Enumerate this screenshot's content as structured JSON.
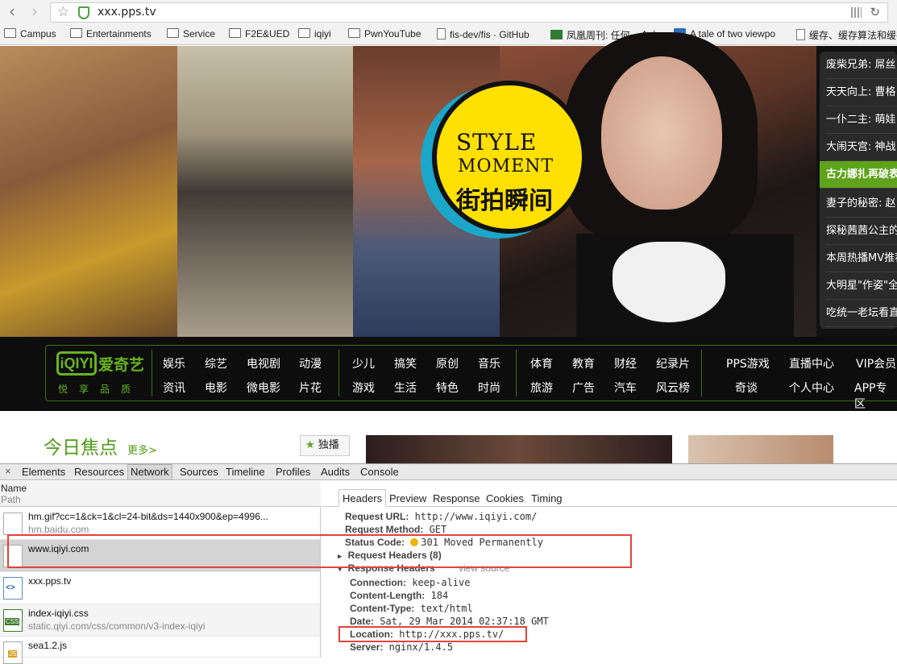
{
  "browser": {
    "url": "xxx.pps.tv",
    "bookmarks": [
      {
        "label": "Campus",
        "icon": "folder-icon"
      },
      {
        "label": "Entertainments",
        "icon": "folder-icon"
      },
      {
        "label": "Service",
        "icon": "folder-icon"
      },
      {
        "label": "F2E&UED",
        "icon": "folder-icon"
      },
      {
        "label": "iqiyi",
        "icon": "folder-icon"
      },
      {
        "label": "PwnYouTube",
        "icon": "folder-icon"
      },
      {
        "label": "fis-dev/fis · GitHub",
        "icon": "page-icon"
      },
      {
        "label": "凤凰周刊: 任何一个方",
        "icon": "fenghuang-icon"
      },
      {
        "label": "A tale of two viewpo",
        "icon": "q-icon"
      },
      {
        "label": "缓存、缓存算法和缓存",
        "icon": "page-icon"
      }
    ]
  },
  "hero": {
    "style_line1": "STYLE",
    "style_line2": "MOMENT",
    "style_line3": "街拍瞬间",
    "side_items": [
      "废柴兄弟: 屌丝",
      "天天向上: 曹格",
      "一仆二主: 萌娃",
      "大闹天宫: 神战",
      "古力娜扎再破表",
      "妻子的秘密: 赵",
      "探秘茜茜公主的",
      "本周热播MV推荐",
      "大明星\"作姿\"全",
      "吃统一老坛看直"
    ],
    "active_index": 4
  },
  "nav": {
    "logo_mark": "iQIYI",
    "logo_text": "爱奇艺",
    "slogan": "悦享品质",
    "row1": [
      "娱乐",
      "综艺",
      "电视剧",
      "动漫",
      "少儿",
      "搞笑",
      "原创",
      "音乐",
      "体育",
      "教育",
      "财经",
      "纪录片",
      "PPS游戏",
      "直播中心",
      "VIP会员"
    ],
    "row2": [
      "资讯",
      "电影",
      "微电影",
      "片花",
      "游戏",
      "生活",
      "特色",
      "时尚",
      "旅游",
      "广告",
      "汽车",
      "风云榜",
      "奇谈",
      "个人中心",
      "APP专区"
    ]
  },
  "content": {
    "focus_title": "今日焦点",
    "more": "更多>",
    "dubo": "独播"
  },
  "devtools": {
    "tabs": [
      "Elements",
      "Resources",
      "Network",
      "Sources",
      "Timeline",
      "Profiles",
      "Audits",
      "Console"
    ],
    "active_tab": "Network",
    "col_name": "Name",
    "col_path": "Path",
    "requests": [
      {
        "name": "hm.gif?cc=1&ck=1&cl=24-bit&ds=1440x900&ep=4996...",
        "path": "hm.baidu.com",
        "type": "blank"
      },
      {
        "name": "www.iqiyi.com",
        "path": "",
        "type": "blank"
      },
      {
        "name": "xxx.pps.tv",
        "path": "",
        "type": "html"
      },
      {
        "name": "index-iqiyi.css",
        "path": "static.qiyi.com/css/common/v3-index-iqiyi",
        "type": "css"
      },
      {
        "name": "sea1.2.js",
        "path": "",
        "type": "js"
      }
    ],
    "subtabs": [
      "Headers",
      "Preview",
      "Response",
      "Cookies",
      "Timing"
    ],
    "headers": {
      "request_url_label": "Request URL:",
      "request_url": "http://www.iqiyi.com/",
      "request_method_label": "Request Method:",
      "request_method": "GET",
      "status_label": "Status Code:",
      "status": "301 Moved Permanently",
      "request_headers": "Request Headers (8)",
      "response_headers": "Response Headers",
      "view_source": "view source",
      "response": [
        {
          "k": "Connection:",
          "v": "keep-alive"
        },
        {
          "k": "Content-Length:",
          "v": "184"
        },
        {
          "k": "Content-Type:",
          "v": "text/html"
        },
        {
          "k": "Date:",
          "v": "Sat, 29 Mar 2014 02:37:18 GMT"
        },
        {
          "k": "Location:",
          "v": "http://xxx.pps.tv/"
        },
        {
          "k": "Server:",
          "v": "nginx/1.4.5"
        }
      ]
    }
  },
  "colors": {
    "iqiyi_green": "#68b41f",
    "highlight_red": "#e2443a",
    "status_dot": "#f0b400"
  }
}
